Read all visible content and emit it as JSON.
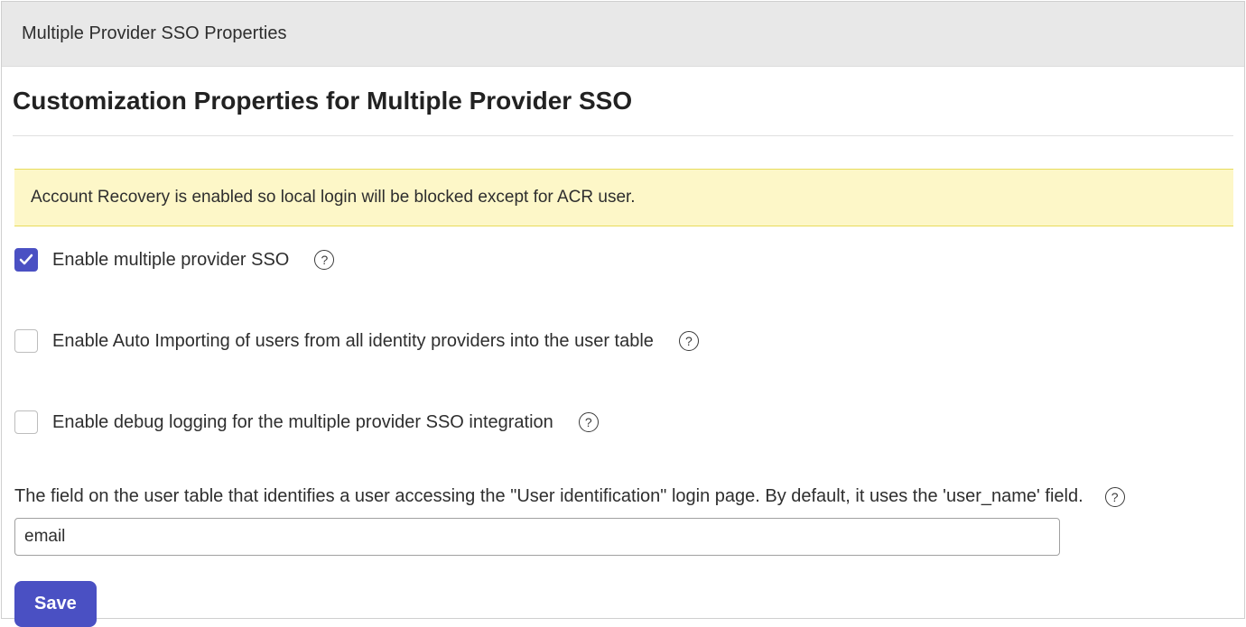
{
  "header": {
    "title": "Multiple Provider SSO Properties"
  },
  "page": {
    "title": "Customization Properties for Multiple Provider SSO"
  },
  "banner": {
    "text": "Account Recovery is enabled so local login will be blocked except for ACR user."
  },
  "options": {
    "enable_sso": {
      "label": "Enable multiple provider SSO",
      "checked": true
    },
    "auto_import": {
      "label": "Enable Auto Importing of users from all identity providers into the user table",
      "checked": false
    },
    "debug_logging": {
      "label": "Enable debug logging for the multiple provider SSO integration",
      "checked": false
    }
  },
  "field": {
    "label": "The field on the user table that identifies a user accessing the \"User identification\" login page. By default, it uses the 'user_name' field.",
    "value": "email"
  },
  "actions": {
    "save_label": "Save"
  },
  "help_icon_glyph": "?"
}
